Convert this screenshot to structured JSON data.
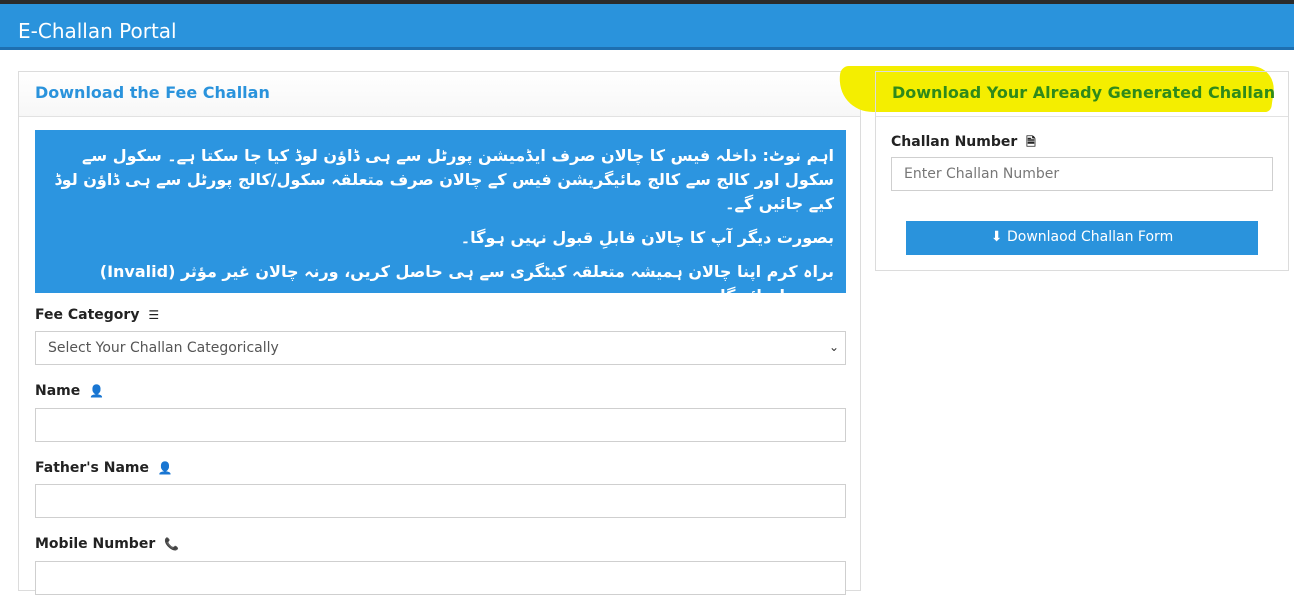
{
  "app": {
    "title": "E-Challan Portal"
  },
  "left_panel": {
    "title": "Download the Fee Challan",
    "notice": {
      "line1": "اہم نوٹ: داخلہ فیس کا چالان صرف ایڈمیشن پورٹل سے ہی ڈاؤن لوڈ کیا جا سکتا ہے۔ سکول سے سکول اور کالج سے کالج مائیگریشن فیس کے چالان صرف متعلقہ سکول/کالج پورٹل سے ہی ڈاؤن لوڈ کیے جائیں گے۔",
      "line2": "بصورت دیگر آپ کا چالان قابلِ قبول نہیں ہوگا۔",
      "line3": "براہ کرم اپنا چالان ہمیشہ متعلقہ کیٹگری سے ہی حاصل کریں، ورنہ چالان غیر مؤثر (Invalid) سمجھا جائے گا۔"
    },
    "fee_category": {
      "label": "Fee Category",
      "selected": "Select Your Challan Categorically"
    },
    "name": {
      "label": "Name",
      "value": ""
    },
    "fathers_name": {
      "label": "Father's Name",
      "value": ""
    },
    "mobile": {
      "label": "Mobile Number",
      "value": ""
    }
  },
  "right_panel": {
    "title": "Download Your Already Generated Challan",
    "challan_number": {
      "label": "Challan Number",
      "placeholder": "Enter Challan Number"
    },
    "button_label": "Downlaod Challan Form"
  },
  "colors": {
    "header": "#2a93dc",
    "notice": "#2c95e0",
    "highlight": "#f4ee00",
    "right_title": "#2f8a1a"
  },
  "icons": [
    "list-icon",
    "user-icon",
    "phone-icon",
    "document-icon",
    "download-icon",
    "chevron-down-icon"
  ]
}
